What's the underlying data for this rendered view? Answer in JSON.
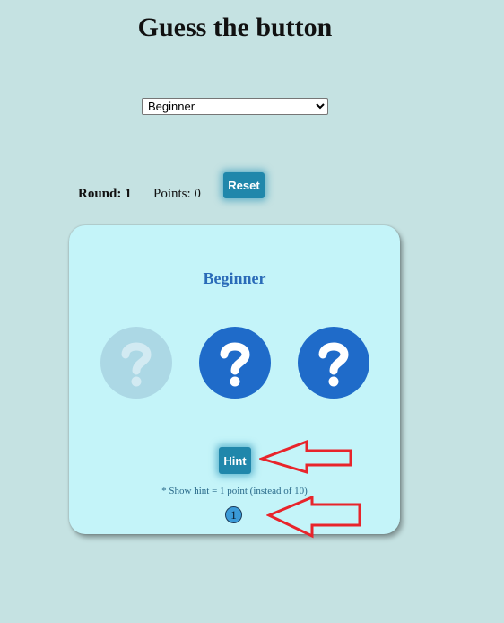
{
  "header": {
    "title": "Guess the button"
  },
  "level_select": {
    "selected": "Beginner"
  },
  "score": {
    "round_label": "Round: 1",
    "points_label": "Points: 0"
  },
  "controls": {
    "reset_label": "Reset",
    "hint_label": "Hint"
  },
  "game": {
    "level_title": "Beginner",
    "question_buttons": [
      {
        "state": "disabled",
        "icon": "question-mark-icon"
      },
      {
        "state": "active",
        "icon": "question-mark-icon"
      },
      {
        "state": "active",
        "icon": "question-mark-icon"
      }
    ],
    "hint_note": "* Show hint = 1 point (instead of 10)",
    "hint_count": "1"
  },
  "colors": {
    "background": "#c5e2e2",
    "card": "#c4f4f9",
    "button": "#2087ab",
    "question_active": "#1f6bc9",
    "question_disabled": "#acd8e5",
    "level_title": "#2a6bb8",
    "annotation_arrow": "#e8242b"
  }
}
